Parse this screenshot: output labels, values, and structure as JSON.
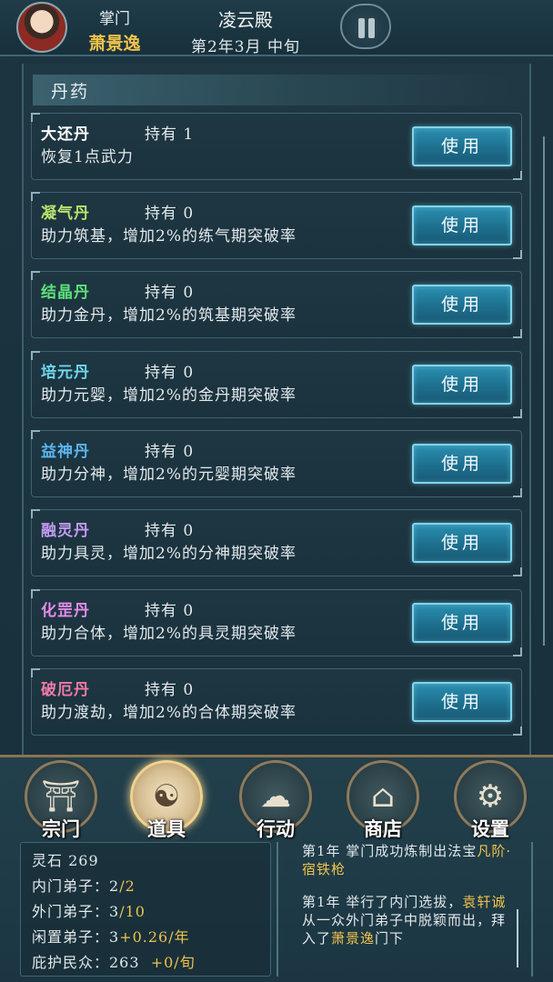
{
  "header": {
    "role": "掌门",
    "name": "萧景逸",
    "sect": "凌云殿",
    "date": "第2年3月 中旬"
  },
  "panel": {
    "title": "丹药",
    "button_label": "使用",
    "items": [
      {
        "name": "大还丹",
        "hold": "持有 1",
        "desc": "恢复1点武力",
        "color": "#ffffff"
      },
      {
        "name": "凝气丹",
        "hold": "持有 0",
        "desc": "助力筑基，增加2%的练气期突破率",
        "color": "#b7e36a"
      },
      {
        "name": "结晶丹",
        "hold": "持有 0",
        "desc": "助力金丹，增加2%的筑基期突破率",
        "color": "#5fe07a"
      },
      {
        "name": "培元丹",
        "hold": "持有 0",
        "desc": "助力元婴，增加2%的金丹期突破率",
        "color": "#6fd6ea"
      },
      {
        "name": "益神丹",
        "hold": "持有 0",
        "desc": "助力分神，增加2%的元婴期突破率",
        "color": "#5cb4f0"
      },
      {
        "name": "融灵丹",
        "hold": "持有 0",
        "desc": "助力具灵，增加2%的分神期突破率",
        "color": "#c49af0"
      },
      {
        "name": "化罡丹",
        "hold": "持有 0",
        "desc": "助力合体，增加2%的具灵期突破率",
        "color": "#e68be8"
      },
      {
        "name": "破厄丹",
        "hold": "持有 0",
        "desc": "助力渡劫，增加2%的合体期突破率",
        "color": "#f07aa8"
      }
    ]
  },
  "nav": [
    {
      "label": "宗门",
      "icon": "sect-gate-icon",
      "glyph": "⛩"
    },
    {
      "label": "道具",
      "icon": "item-bag-icon",
      "glyph": "☯"
    },
    {
      "label": "行动",
      "icon": "action-cloud-icon",
      "glyph": "☁"
    },
    {
      "label": "商店",
      "icon": "shop-building-icon",
      "glyph": "⌂"
    },
    {
      "label": "设置",
      "icon": "gear-icon",
      "glyph": "⚙"
    }
  ],
  "stats": {
    "spirit_stone": "灵石 269",
    "inner_label": "内门弟子：2",
    "inner_max": "/2",
    "outer_label": "外门弟子：3",
    "outer_max": "/10",
    "idle_label": "闲置弟子：3",
    "idle_gain": "+0.26/年",
    "protect_label": "庇护民众：263",
    "protect_gain": "+0/旬"
  },
  "log": {
    "entry1_prefix": "第1年 掌门成功炼制出法宝",
    "entry1_item": "凡阶·宿铁枪",
    "entry2_prefix": "第1年 举行了内门选拔，",
    "entry2_person": "袁轩诚",
    "entry2_mid": "从一众外门弟子中脱颖而出，拜入了",
    "entry2_master": "萧景逸",
    "entry2_suffix": "门下"
  }
}
